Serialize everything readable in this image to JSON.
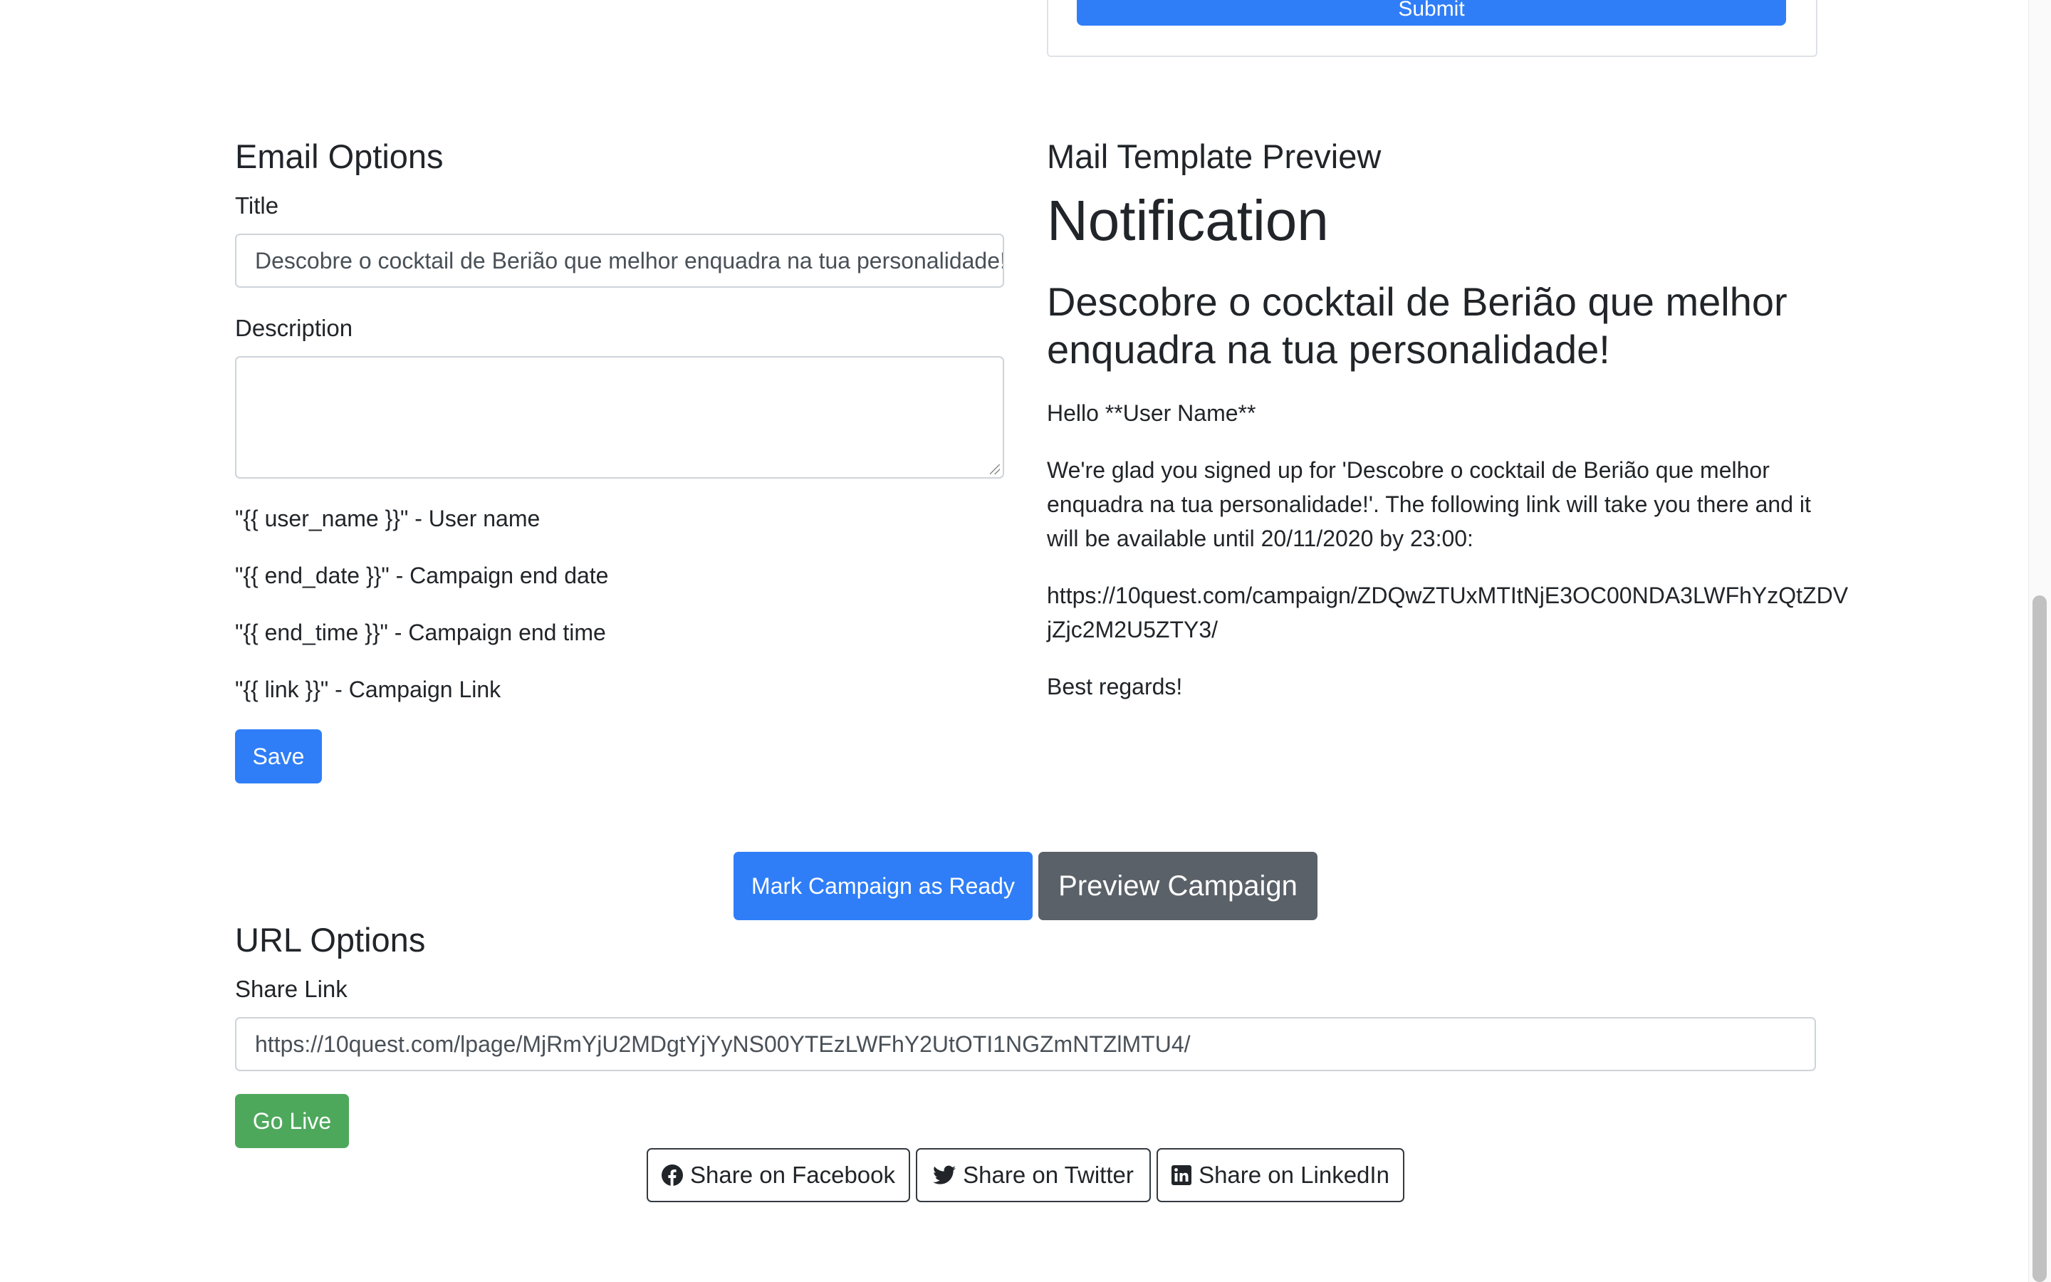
{
  "top_card": {
    "submit_label": "Submit"
  },
  "email_options": {
    "heading": "Email Options",
    "title_label": "Title",
    "title_value": "Descobre o cocktail de Berião que melhor enquadra na tua personalidade!",
    "description_label": "Description",
    "description_value": "",
    "variables": [
      "\"{{ user_name }}\" - User name",
      "\"{{ end_date }}\" - Campaign end date",
      "\"{{ end_time }}\" - Campaign end time",
      "\"{{ link }}\" - Campaign Link"
    ],
    "save_label": "Save"
  },
  "preview": {
    "heading": "Mail Template Preview",
    "notification": "Notification",
    "title": "Descobre o cocktail de Berião que melhor enquadra na tua personalidade!",
    "greeting": "Hello **User Name**",
    "body": "We're glad you signed up for 'Descobre o cocktail de Berião que melhor enquadra na tua personalidade!'. The following link will take you there and it will be available until 20/11/2020 by 23:00:",
    "link": "https://10quest.com/campaign/ZDQwZTUxMTItNjE3OC00NDA3LWFhYzQtZDVjZjc2M2U5ZTY3/",
    "signoff": "Best regards!"
  },
  "actions": {
    "mark_ready_label": "Mark Campaign as Ready",
    "preview_label": "Preview Campaign"
  },
  "url_options": {
    "heading": "URL Options",
    "share_link_label": "Share Link",
    "share_link_value": "https://10quest.com/lpage/MjRmYjU2MDgtYjYyNS00YTEzLWFhY2UtOTI1NGZmNTZlMTU4/",
    "go_live_label": "Go Live"
  },
  "share": {
    "facebook_label": "Share on Facebook",
    "twitter_label": "Share on Twitter",
    "linkedin_label": "Share on LinkedIn"
  },
  "colors": {
    "primary": "#2f7ef7",
    "secondary": "#5a6168",
    "success": "#4ea85c",
    "text": "#212529"
  }
}
